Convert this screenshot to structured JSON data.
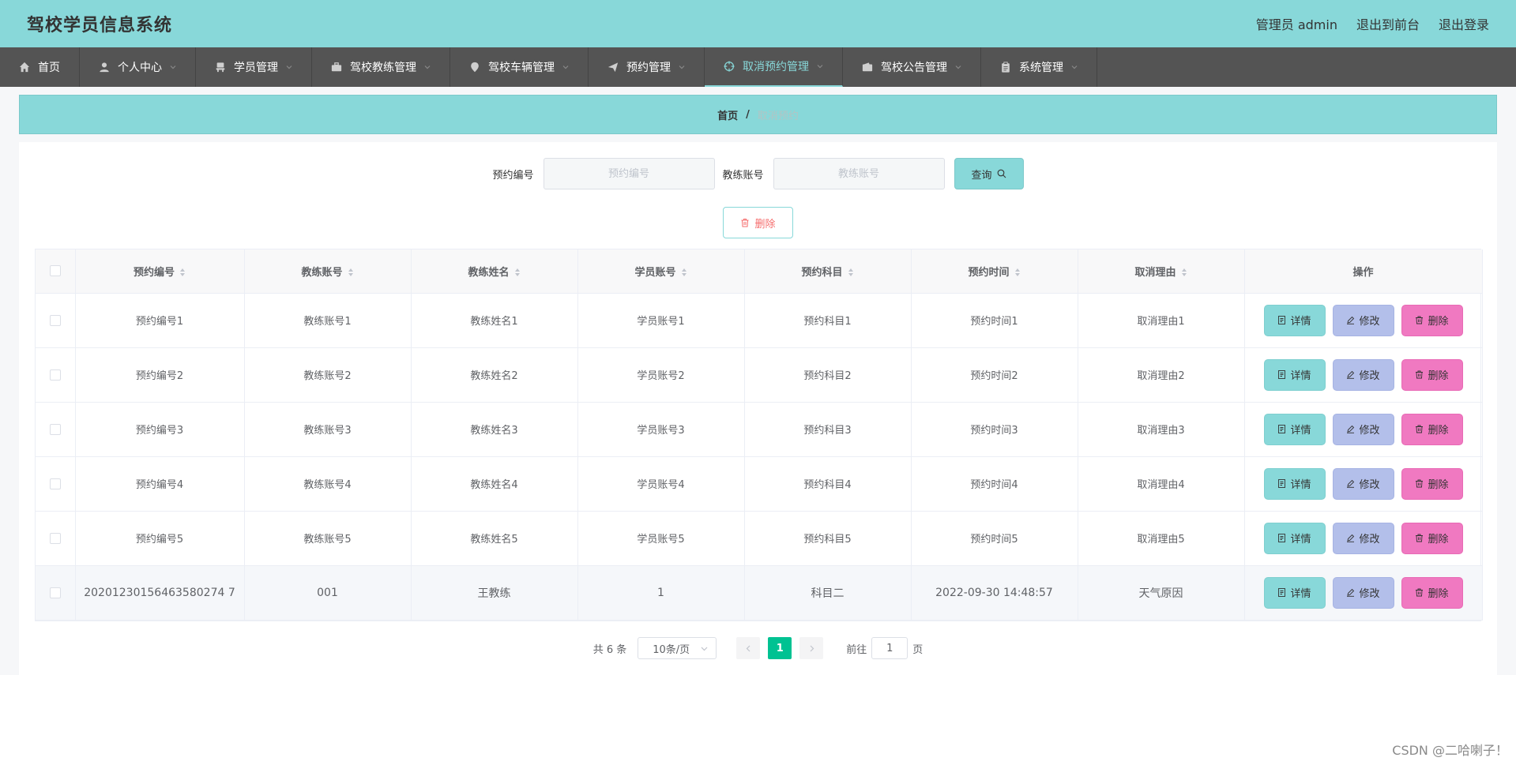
{
  "header": {
    "title": "驾校学员信息系统",
    "admin_label": "管理员 admin",
    "back_label": "退出到前台",
    "logout_label": "退出登录"
  },
  "nav": {
    "items": [
      {
        "label": "首页",
        "icon": "home-icon"
      },
      {
        "label": "个人中心",
        "icon": "user-icon"
      },
      {
        "label": "学员管理",
        "icon": "chair-icon"
      },
      {
        "label": "驾校教练管理",
        "icon": "briefcase-icon"
      },
      {
        "label": "驾校车辆管理",
        "icon": "location-icon"
      },
      {
        "label": "预约管理",
        "icon": "send-icon"
      },
      {
        "label": "取消预约管理",
        "icon": "crosshair-icon"
      },
      {
        "label": "驾校公告管理",
        "icon": "wallet-icon"
      },
      {
        "label": "系统管理",
        "icon": "clipboard-icon"
      }
    ],
    "active_index": 6
  },
  "breadcrumb": {
    "home": "首页",
    "separator": "/",
    "current": "取消预约"
  },
  "search": {
    "field1_label": "预约编号",
    "field1_placeholder": "预约编号",
    "field2_label": "教练账号",
    "field2_placeholder": "教练账号",
    "button_label": "查询"
  },
  "bulk_delete_label": "删除",
  "table": {
    "columns": [
      "预约编号",
      "教练账号",
      "教练姓名",
      "学员账号",
      "预约科目",
      "预约时间",
      "取消理由",
      "操作"
    ],
    "rows": [
      [
        "预约编号1",
        "教练账号1",
        "教练姓名1",
        "学员账号1",
        "预约科目1",
        "预约时间1",
        "取消理由1"
      ],
      [
        "预约编号2",
        "教练账号2",
        "教练姓名2",
        "学员账号2",
        "预约科目2",
        "预约时间2",
        "取消理由2"
      ],
      [
        "预约编号3",
        "教练账号3",
        "教练姓名3",
        "学员账号3",
        "预约科目3",
        "预约时间3",
        "取消理由3"
      ],
      [
        "预约编号4",
        "教练账号4",
        "教练姓名4",
        "学员账号4",
        "预约科目4",
        "预约时间4",
        "取消理由4"
      ],
      [
        "预约编号5",
        "教练账号5",
        "教练姓名5",
        "学员账号5",
        "预约科目5",
        "预约时间5",
        "取消理由5"
      ],
      [
        "20201230156463580274 7",
        "001",
        "王教练",
        "1",
        "科目二",
        "2022-09-30 14:48:57",
        "天气原因"
      ]
    ],
    "actions": {
      "detail": "详情",
      "edit": "修改",
      "delete": "删除"
    }
  },
  "pagination": {
    "total_text": "共 6 条",
    "page_size": "10条/页",
    "current_page": "1",
    "goto_prefix": "前往",
    "goto_value": "1",
    "goto_suffix": "页"
  },
  "watermark": "CSDN @二哈喇子！",
  "colors": {
    "header_bg": "#88d8d9",
    "nav_bg": "#545454",
    "detail_btn": "#88d8d9",
    "edit_btn": "#b3bfea",
    "delete_btn": "#f079c1",
    "pager_active": "#00c292"
  }
}
